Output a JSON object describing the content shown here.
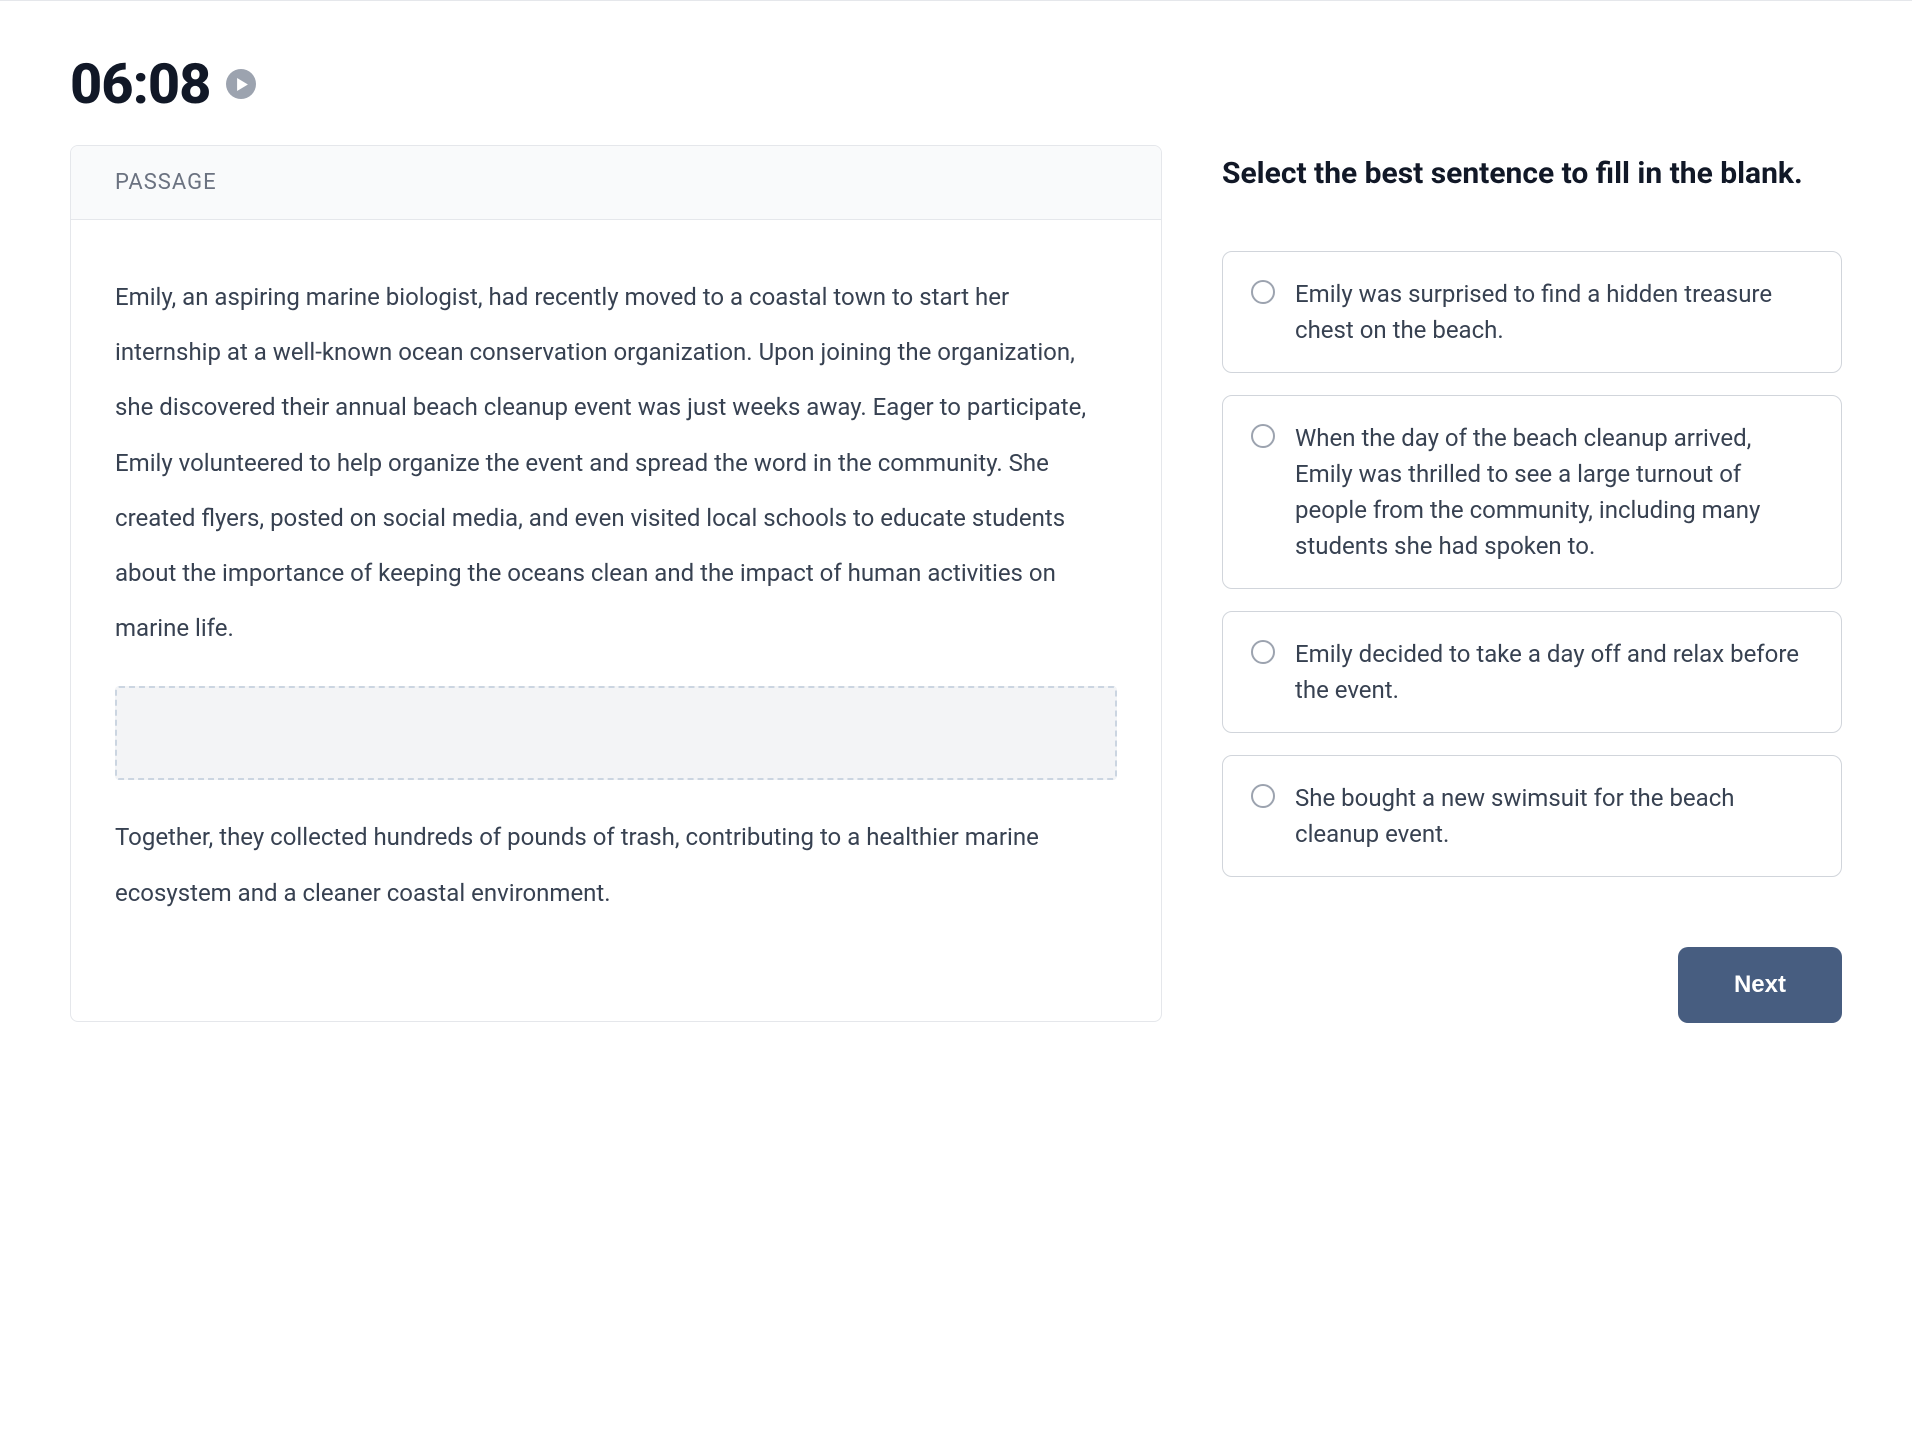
{
  "timer": {
    "value": "06:08"
  },
  "passage": {
    "header": "PASSAGE",
    "para1": "Emily, an aspiring marine biologist, had recently moved to a coastal town to start her internship at a well-known ocean conservation organization. Upon joining the organization, she discovered their annual beach cleanup event was just weeks away. Eager to participate, Emily volunteered to help organize the event and spread the word in the community. She created flyers, posted on social media, and even visited local schools to educate students about the importance of keeping the oceans clean and the impact of human activities on marine life.",
    "para2": "Together, they collected hundreds of pounds of trash, contributing to a healthier marine ecosystem and a cleaner coastal environment."
  },
  "question": {
    "prompt": "Select the best sentence to fill in the blank.",
    "options": [
      "Emily was surprised to find a hidden treasure chest on the beach.",
      "When the day of the beach cleanup arrived, Emily was thrilled to see a large turnout of people from the community, including many students she had spoken to.",
      "Emily decided to take a day off and relax before the event.",
      "She bought a new swimsuit for the beach cleanup event."
    ],
    "next_label": "Next"
  }
}
